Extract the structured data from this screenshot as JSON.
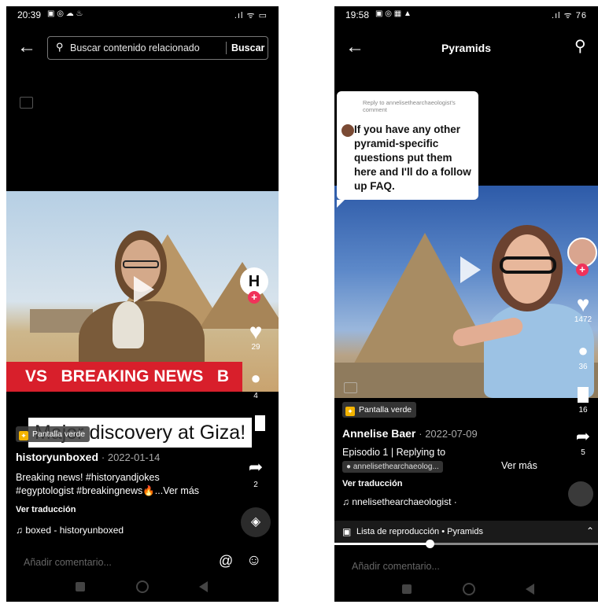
{
  "left": {
    "status": {
      "time": "20:39",
      "icons": "▣ ◎ ☁ ♨",
      "right": ".ıl ᯤ ▭"
    },
    "search": {
      "placeholder": "Buscar contenido relacionado",
      "button": "Buscar"
    },
    "overlays": {
      "breaking": "VS   BREAKING NEWS   B",
      "headline": "Major discovery at Giza!"
    },
    "actions": {
      "likes": "29",
      "comments": "4",
      "shares": "2"
    },
    "tag": "Pantalla verde",
    "username": "historyunboxed",
    "date": "· 2022-01-14",
    "caption_line1": "Breaking news! #historyandjokes",
    "caption_line2": "#egyptologist #breakingnews🔥...Ver más",
    "translate": "Ver traducción",
    "music": "♫ boxed - historyunboxed",
    "comment_placeholder": "Añadir comentario...",
    "at_icon": "@",
    "emoji_icon": "☺",
    "avatar_letter": "H"
  },
  "right": {
    "status": {
      "time": "19:58",
      "icons": "▣ ◎ ▦ ▲",
      "right": ".ıl ᯤ 76"
    },
    "title": "Pyramids",
    "reply": {
      "meta": "Reply to annelisethearchaeologist's comment",
      "text": "If you have any other pyramid-specific questions put them here and I'll do a follow up FAQ."
    },
    "actions": {
      "likes": "1472",
      "comments": "36",
      "saves": "16",
      "shares": "5"
    },
    "tag": "Pantalla verde",
    "username": "Annelise Baer",
    "date": "· 2022-07-09",
    "episode": "Episodio 1 | Replying to",
    "mention": "● annelisethearchaeolog...",
    "more": "Ver más",
    "translate": "Ver traducción",
    "music": "♫ nnelisethearchaeologist ·",
    "playlist": "Lista de reproducción • Pyramids",
    "playlist_progress": 0.36,
    "comment_placeholder": "Añadir comentario..."
  }
}
